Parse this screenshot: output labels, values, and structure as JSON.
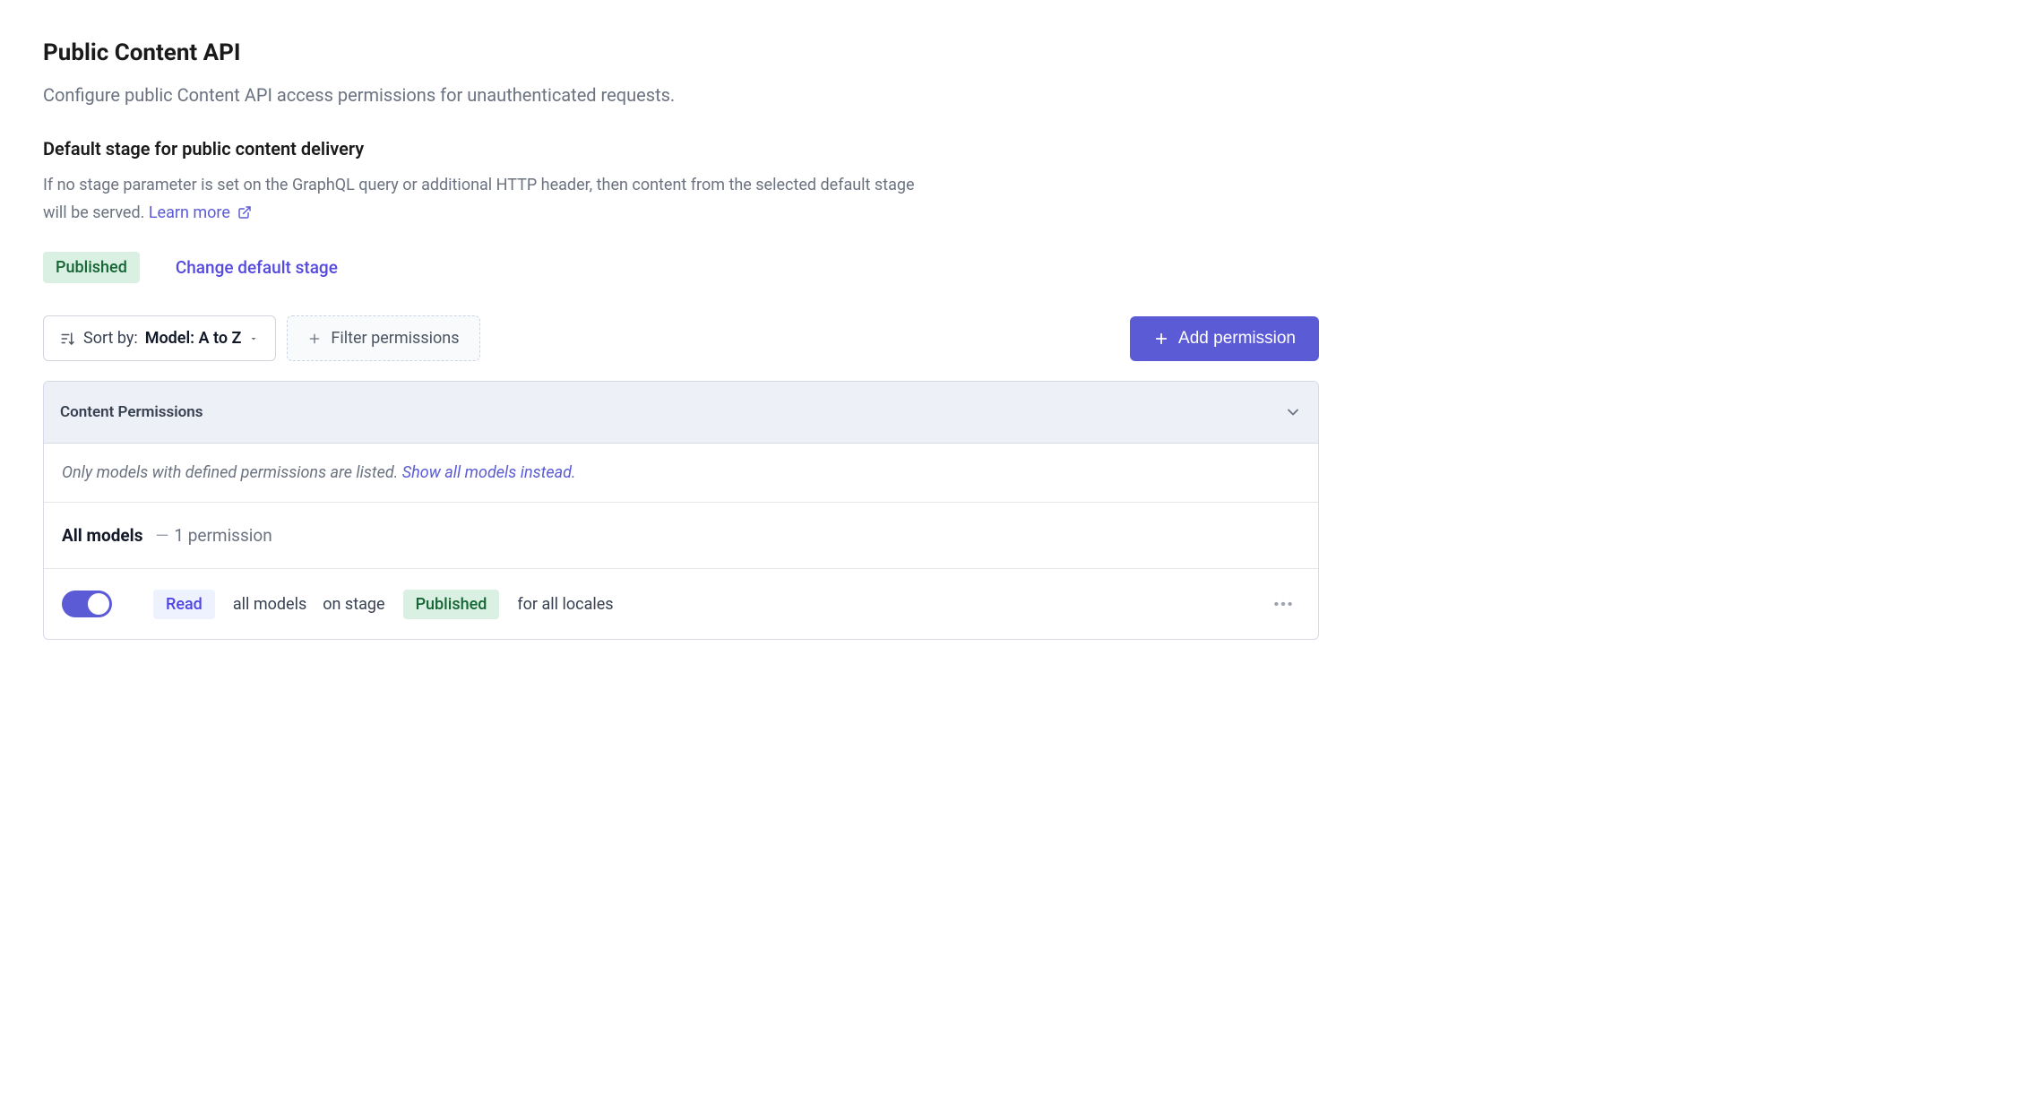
{
  "header": {
    "title": "Public Content API",
    "subtitle": "Configure public Content API access permissions for unauthenticated requests."
  },
  "default_stage": {
    "heading": "Default stage for public content delivery",
    "desc_part1": "If no stage parameter is set on the GraphQL query or additional HTTP header, then content from the selected default stage will be served. ",
    "learn_more": "Learn more",
    "badge": "Published",
    "change_link": "Change default stage"
  },
  "toolbar": {
    "sort_prefix": "Sort by:",
    "sort_value": "Model: A to Z",
    "filter_label": "Filter permissions",
    "add_label": "Add permission"
  },
  "panel": {
    "title": "Content Permissions",
    "info_text": "Only models with defined permissions are listed. ",
    "info_link": "Show all models instead.",
    "summary_label": "All models",
    "summary_dash": "—",
    "summary_count": "1 permission",
    "perm": {
      "action": "Read",
      "scope": "all models",
      "stage_prefix": "on stage",
      "stage": "Published",
      "locales": "for all locales"
    }
  },
  "colors": {
    "accent": "#5b5bd6",
    "green_bg": "#d9f0e3",
    "green_fg": "#166534"
  }
}
